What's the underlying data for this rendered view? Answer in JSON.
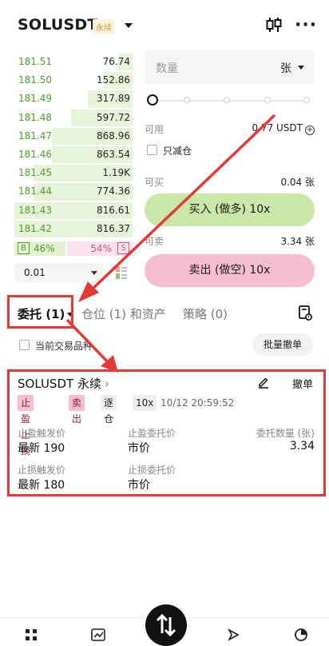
{
  "header": {
    "symbol": "SOLUSDT",
    "badge": "永续"
  },
  "orderbook": {
    "rows": [
      {
        "price": "181.51",
        "qty": "76.74",
        "depth": 0.12
      },
      {
        "price": "181.50",
        "qty": "152.86",
        "depth": 0.24
      },
      {
        "price": "181.49",
        "qty": "317.89",
        "depth": 0.38
      },
      {
        "price": "181.48",
        "qty": "597.72",
        "depth": 0.52
      },
      {
        "price": "181.47",
        "qty": "868.96",
        "depth": 0.68
      },
      {
        "price": "181.46",
        "qty": "863.54",
        "depth": 0.68
      },
      {
        "price": "181.45",
        "qty": "1.19K",
        "depth": 0.84
      },
      {
        "price": "181.44",
        "qty": "774.36",
        "depth": 0.84
      },
      {
        "price": "181.43",
        "qty": "816.61",
        "depth": 1.0
      },
      {
        "price": "181.42",
        "qty": "816.37",
        "depth": 1.0
      }
    ],
    "buy_tag": "B",
    "buy_pct": "46%",
    "sell_pct": "54%",
    "sell_tag": "S",
    "precision": "0.01"
  },
  "form": {
    "qty_placeholder": "数量",
    "qty_unit": "张",
    "available_label": "可用",
    "available_value": "0.77 USDT",
    "reduce_only_label": "只减仓",
    "can_buy_label": "可买",
    "can_buy_value": "0.04 张",
    "buy_button": "买入 (做多) 10x",
    "can_sell_label": "可卖",
    "can_sell_value": "3.34 张",
    "sell_button": "卖出 (做空) 10x",
    "slider_percent": 0
  },
  "tabs": {
    "orders": "委托 (1)",
    "positions": "仓位 (1) 和资产",
    "strategy": "策略 (0)"
  },
  "filter": {
    "current_symbol": "当前交易品种",
    "cancel_all": "批量撤单"
  },
  "order": {
    "title": "SOLUSDT 永续",
    "cancel": "撤单",
    "tags": [
      "止盈止损",
      "卖出",
      "逐仓",
      "10x"
    ],
    "time": "10/12 20:59:52",
    "tp_trigger_label": "止盈触发价",
    "tp_trigger_value": "最新 190",
    "tp_order_label": "止盈委托价",
    "tp_order_value": "市价",
    "qty_label": "委托数量 (张)",
    "qty_value": "3.34",
    "sl_trigger_label": "止损触发价",
    "sl_trigger_value": "最新 180",
    "sl_order_label": "止损委托价",
    "sl_order_value": "市价"
  },
  "colors": {
    "bid_green": "#4a9f24",
    "ask_pink": "#d1577c",
    "buy_button": "#c9e7a6",
    "sell_button": "#f7bdd2",
    "annotation_red": "#e53935"
  },
  "icons": [
    "kline-icon",
    "more-icon",
    "plus-icon",
    "history-icon",
    "edit-icon",
    "grid-icon",
    "chart-icon",
    "trade-icon",
    "compass-icon",
    "pie-icon"
  ]
}
